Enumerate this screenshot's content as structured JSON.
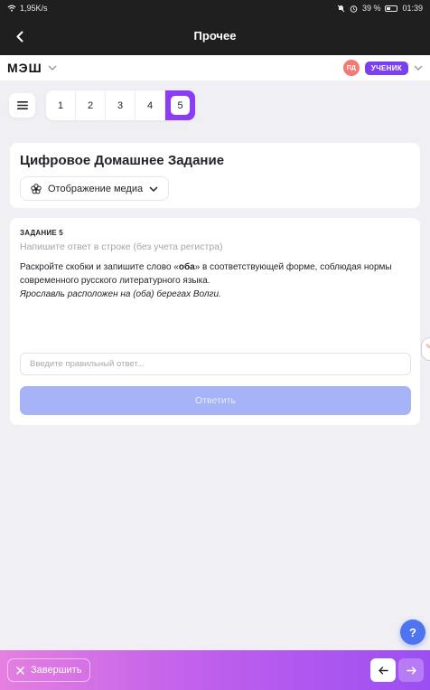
{
  "status_bar": {
    "speed": "1,95K/s",
    "battery": "39 %",
    "time": "01:39"
  },
  "title_bar": {
    "title": "Прочее"
  },
  "app_header": {
    "logo": "МЭШ",
    "avatar_initials": "ПД",
    "role": "УЧЕНИК"
  },
  "task_tabs": [
    "1",
    "2",
    "3",
    "4",
    "5"
  ],
  "active_tab": "5",
  "homework": {
    "title": "Цифровое Домашнее Задание",
    "media_button": "Отображение медиа"
  },
  "task": {
    "label": "ЗАДАНИЕ 5",
    "hint": "Напишите ответ в строке (без учета регистра)",
    "text_before": "Раскройте скобки и запишите слово «",
    "text_bold": "оба",
    "text_after": "» в соответствующей форме, соблюдая нормы современного русского литературного языка.",
    "example": "Ярославль расположен на (оба) берегах Волги.",
    "answer_placeholder": "Введите правильный ответ...",
    "answer_value": "",
    "submit_label": "Ответить"
  },
  "help": {
    "label": "?"
  },
  "bottom_bar": {
    "finish_label": "Завершить"
  },
  "colors": {
    "accent": "#8a3df5",
    "submit_disabled": "#a6b3f7",
    "help": "#4f74f0",
    "avatar": "#f07a74"
  }
}
